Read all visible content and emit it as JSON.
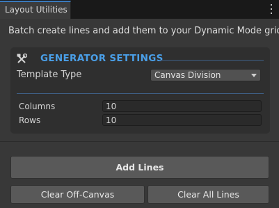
{
  "window": {
    "tab_title": "Layout Utilities",
    "menu_icon": "kebab-menu-icon"
  },
  "description": "Batch create lines and add them to your Dynamic Mode grid.",
  "generator": {
    "title": "GENERATOR SETTINGS",
    "icon": "tools-icon",
    "accent_color": "#4a9fe8",
    "template_type_label": "Template Type",
    "template_type_value": "Canvas Division",
    "columns_label": "Columns",
    "columns_value": "10",
    "rows_label": "Rows",
    "rows_value": "10"
  },
  "actions": {
    "add_lines": "Add Lines",
    "clear_off_canvas": "Clear Off-Canvas",
    "clear_all_lines": "Clear All Lines"
  }
}
